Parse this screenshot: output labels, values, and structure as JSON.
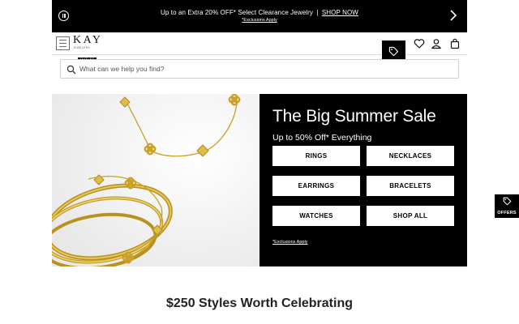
{
  "promo_bar": {
    "message": "Up to an Extra 20% OFF* Select Clearance Jewelry",
    "separator": "|",
    "link": "SHOP NOW",
    "exclusions": "*Exclusions Apply"
  },
  "header": {
    "logo_main": "KAY",
    "logo_tagline": "JEWELERS",
    "logo_outlet": "OUTLET",
    "icons": [
      "menu-icon",
      "tag-icon",
      "heart-icon",
      "account-icon",
      "bag-icon"
    ]
  },
  "search": {
    "placeholder": "What can we help you find?"
  },
  "hero": {
    "title": "The Big Summer Sale",
    "subtitle": "Up to 50% Off* Everything",
    "buttons": [
      "RINGS",
      "NECKLACES",
      "EARRINGS",
      "BRACELETS",
      "WATCHES",
      "SHOP ALL"
    ],
    "exclusions": "*Exclusions Apply"
  },
  "offers_tab": {
    "label": "OFFERS"
  },
  "section": {
    "heading": "$250 Styles Worth Celebrating"
  },
  "colors": {
    "promo_bg": "#000000",
    "panel_bg": "#000000",
    "menu_accent": "#2c7fb8",
    "gold": "#d4af37"
  }
}
